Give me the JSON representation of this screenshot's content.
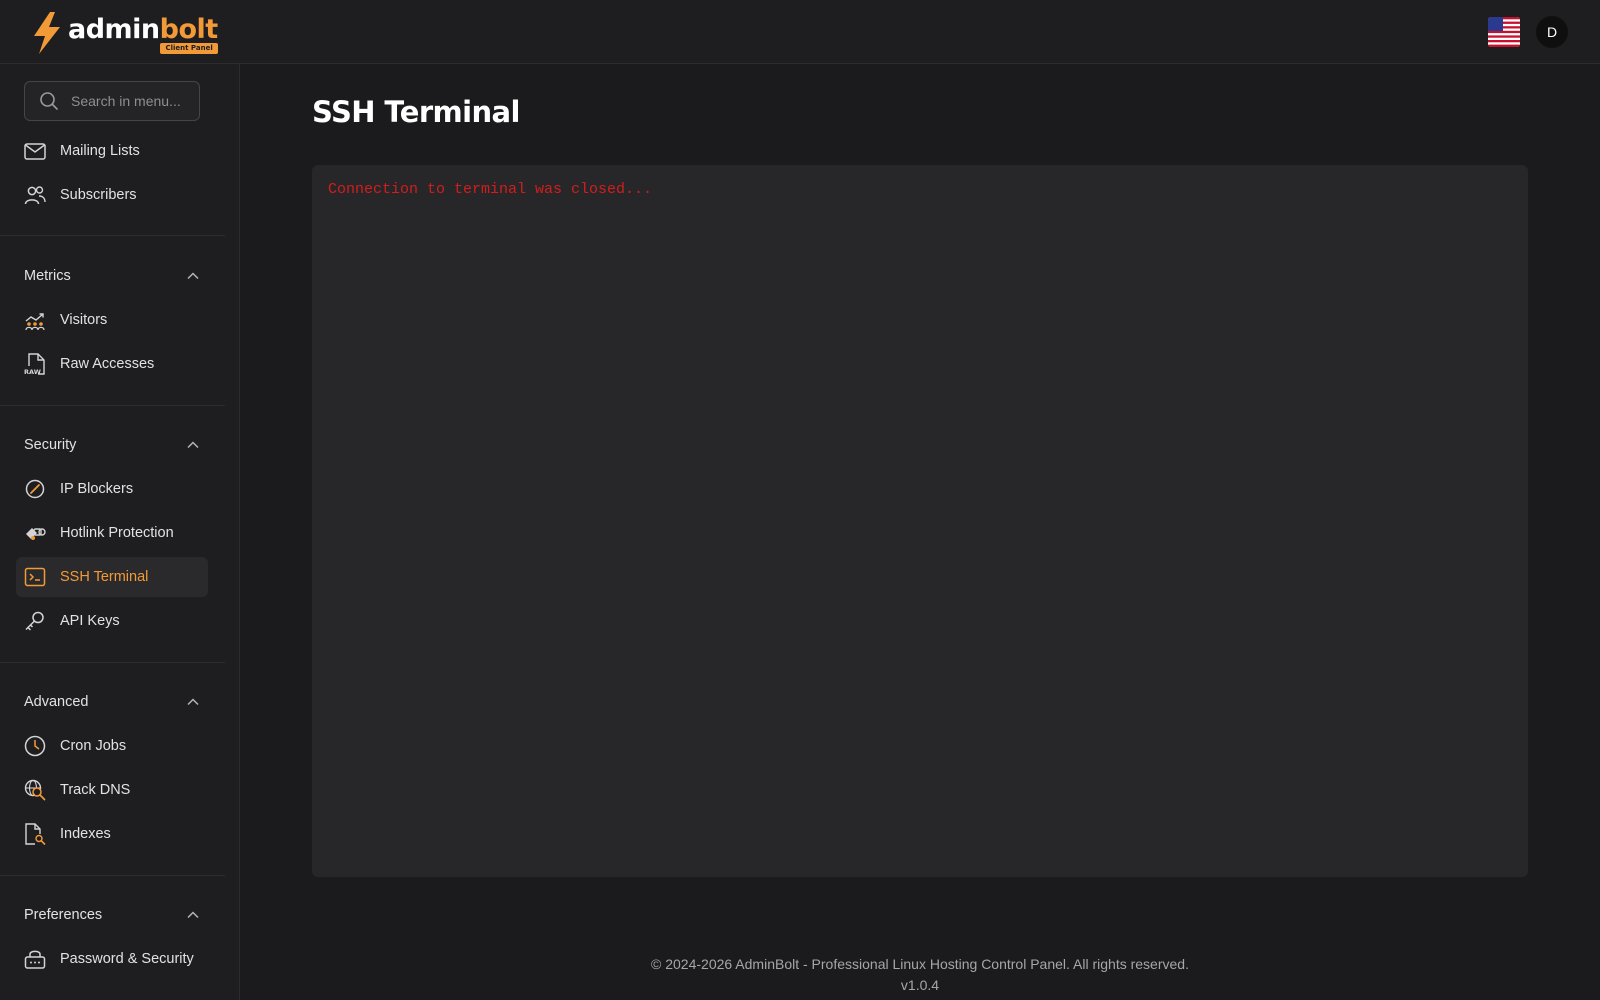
{
  "header": {
    "logo": {
      "word_main": "admin",
      "word_accent": "bolt",
      "badge": "Client Panel"
    },
    "language_flag": "us-flag-icon",
    "user_avatar_initial": "D",
    "accent_color": "#f29a38"
  },
  "sidebar": {
    "search_placeholder": "Search in menu...",
    "top_items": [
      {
        "label": "Mailing Lists",
        "icon": "mail-icon"
      },
      {
        "label": "Subscribers",
        "icon": "users-icon"
      }
    ],
    "sections": [
      {
        "title": "Metrics",
        "items": [
          {
            "label": "Visitors",
            "icon": "visitors-chart-icon"
          },
          {
            "label": "Raw Accesses",
            "icon": "raw-file-icon"
          }
        ]
      },
      {
        "title": "Security",
        "items": [
          {
            "label": "IP Blockers",
            "icon": "block-icon"
          },
          {
            "label": "Hotlink Protection",
            "icon": "hotlink-icon"
          },
          {
            "label": "SSH Terminal",
            "icon": "terminal-icon",
            "active": true
          },
          {
            "label": "API Keys",
            "icon": "key-icon"
          }
        ]
      },
      {
        "title": "Advanced",
        "items": [
          {
            "label": "Cron Jobs",
            "icon": "clock-icon"
          },
          {
            "label": "Track DNS",
            "icon": "dns-search-icon"
          },
          {
            "label": "Indexes",
            "icon": "file-search-icon"
          }
        ]
      },
      {
        "title": "Preferences",
        "items": [
          {
            "label": "Password & Security",
            "icon": "lock-icon"
          }
        ]
      }
    ]
  },
  "main": {
    "title": "SSH Terminal",
    "terminal_message": "Connection to terminal was closed...",
    "terminal_message_color": "#d31d1d"
  },
  "footer": {
    "copyright": "© 2024-2026 AdminBolt - Professional Linux Hosting Control Panel. All rights reserved.",
    "version": "v1.0.4"
  }
}
